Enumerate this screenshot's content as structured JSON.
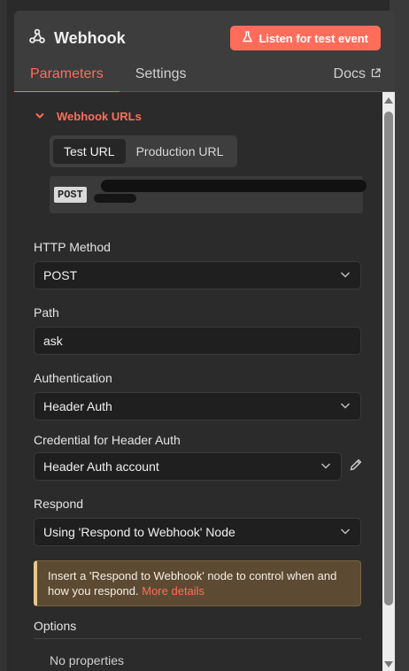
{
  "node": {
    "title": "Webhook",
    "icon": "webhook-icon",
    "listen_button": "Listen for test event",
    "listen_icon": "flask-icon"
  },
  "tabs": {
    "parameters": "Parameters",
    "settings": "Settings",
    "docs": "Docs"
  },
  "webhook_urls": {
    "label": "Webhook URLs",
    "test_url_tab": "Test URL",
    "production_url_tab": "Production URL",
    "method_badge": "POST"
  },
  "fields": {
    "http_method": {
      "label": "HTTP Method",
      "value": "POST"
    },
    "path": {
      "label": "Path",
      "value": "ask"
    },
    "authentication": {
      "label": "Authentication",
      "value": "Header Auth"
    },
    "credential": {
      "label": "Credential for Header Auth",
      "value": "Header Auth account"
    },
    "respond": {
      "label": "Respond",
      "value": "Using 'Respond to Webhook' Node"
    }
  },
  "notice": {
    "text": "Insert a 'Respond to Webhook' node to control when and how you respond.",
    "link": "More details"
  },
  "options": {
    "label": "Options",
    "empty_text": "No properties"
  },
  "colors": {
    "accent": "#ff6d5a",
    "panel_bg": "#3d3d3d",
    "content_bg": "#2b2b2b",
    "notice_bg": "#5c4a33",
    "notice_border": "#e8c78c"
  }
}
